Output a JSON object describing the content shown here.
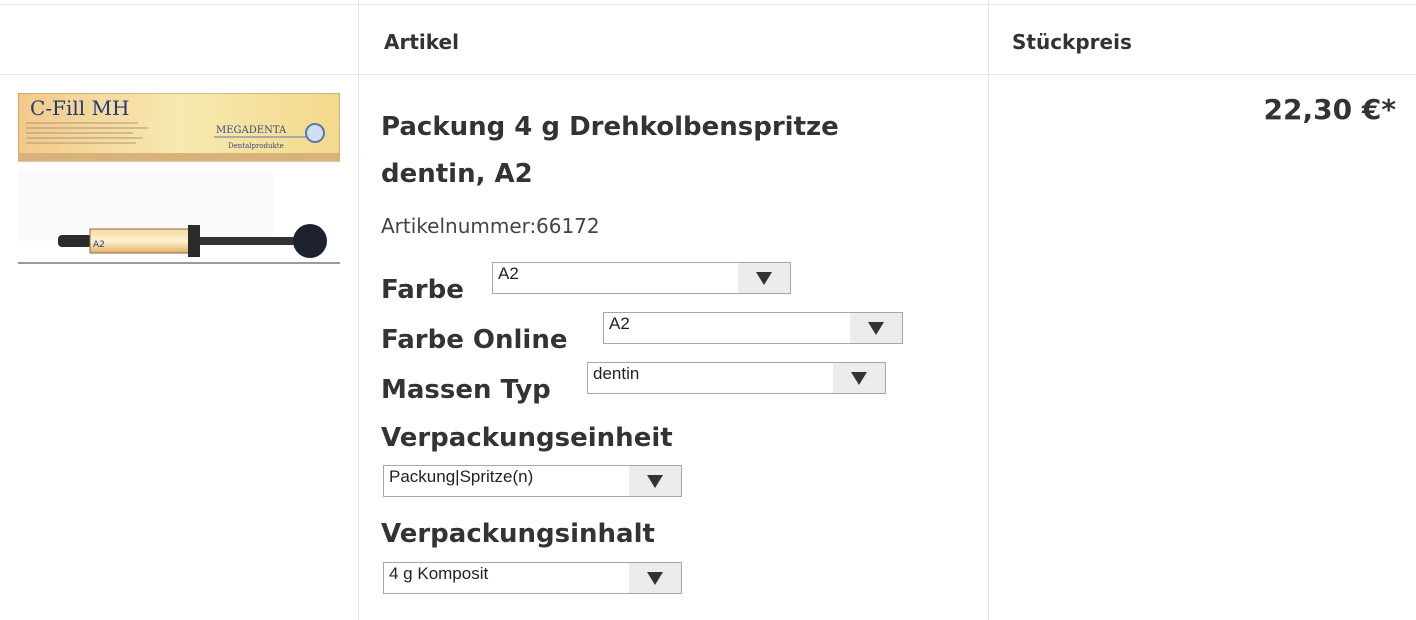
{
  "header": {
    "col_article": "Artikel",
    "col_unit_price": "Stückpreis"
  },
  "product": {
    "image_brand": "C-Fill MH",
    "image_maker": "MEGADENTA",
    "image_maker_sub": "Dentalprodukte",
    "image_shade": "A2",
    "title": "Packung 4 g Drehkolbenspritze dentin, A2",
    "article_number_label": "Artikelnummer:",
    "article_number": "66172",
    "price": "22,30 €*"
  },
  "options": {
    "farbe": {
      "label": "Farbe",
      "value": "A2"
    },
    "farbe_online": {
      "label": "Farbe Online",
      "value": "A2"
    },
    "massen_typ": {
      "label": "Massen Typ",
      "value": "dentin"
    },
    "verpackungseinheit": {
      "label": "Verpackungseinheit",
      "value": "Packung|Spritze(n)"
    },
    "verpackungsinhalt": {
      "label": "Verpackungsinhalt",
      "value": "4 g Komposit"
    }
  },
  "colors": {
    "border": "#e6e6e6",
    "text": "#333333",
    "select_arrow_bg": "#ececec"
  },
  "icons": {
    "dropdown": "triangle-down-icon"
  }
}
